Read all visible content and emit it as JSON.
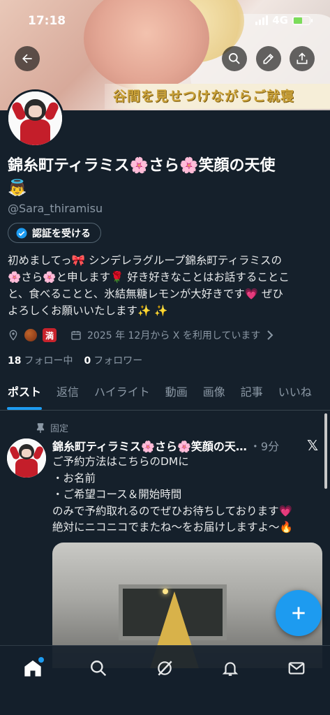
{
  "status_bar": {
    "time": "17:18",
    "network": "4G"
  },
  "banner": {
    "caption": "谷間を見せつけながらご就寝"
  },
  "header_actions": {
    "back": "back-arrow-icon",
    "search": "search-icon",
    "edit": "pencil-icon",
    "share": "share-icon"
  },
  "profile": {
    "name_line1": "錦糸町ティラミス🌸さら🌸笑顔の天使",
    "name_line2": "👼",
    "handle": "@Sara_thiramisu",
    "verify_label": "認証を受ける",
    "bio_lines": [
      "初めましてっ🎀 シンデレラグループ錦糸町ティラミスの",
      "🌸さら🌸と申します🌹 好き好きなことはお話することこ",
      "と、食べることと、氷結無糖レモンが大好きです💗 ぜひ",
      "よろしくお願いいたします✨ ✨"
    ],
    "location_badge": "満",
    "joined": "2025 年 12月から X を利用しています",
    "following_count": "18",
    "following_label": "フォロー中",
    "followers_count": "0",
    "followers_label": "フォロワー"
  },
  "tabs": [
    "ポスト",
    "返信",
    "ハイライト",
    "動画",
    "画像",
    "記事",
    "いいね"
  ],
  "post": {
    "pinned_label": "固定",
    "name": "錦糸町ティラミス🌸さら🌸笑顔の天…",
    "time": "・9分",
    "lines": [
      "ご予約方法はこちらのDMに",
      "・お名前",
      "・ご希望コース＆開始時間",
      "のみで予約取れるのでぜひお待ちしております💗",
      "絶対にニコニコでまたね〜をお届けしますよ〜🔥"
    ]
  },
  "bottom_nav": [
    "home-icon",
    "search-icon",
    "grok-icon",
    "notifications-icon",
    "messages-icon"
  ],
  "colors": {
    "accent": "#1d9bf0",
    "background": "#15202b",
    "secondary_text": "#8b98a5"
  }
}
